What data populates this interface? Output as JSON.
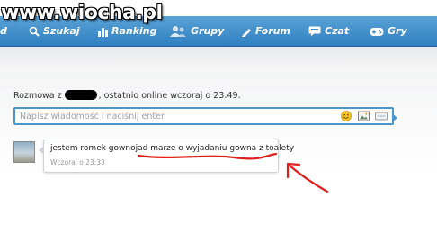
{
  "watermark": "www.wiocha.pl",
  "nav": {
    "items": [
      {
        "label": "d"
      },
      {
        "label": "Szukaj"
      },
      {
        "label": "Ranking"
      },
      {
        "label": "Grupy"
      },
      {
        "label": "Forum"
      },
      {
        "label": "Czat"
      },
      {
        "label": "Gry"
      }
    ]
  },
  "conversation": {
    "heading_prefix": "Rozmowa z",
    "heading_suffix": ", ostatnio online wczoraj o 23:49."
  },
  "composer": {
    "placeholder": "Napisz wiadomość i naciśnij enter",
    "tools": [
      "smiley-icon",
      "image-icon",
      "attachment-icon"
    ]
  },
  "message": {
    "text_part1": "jestem romek gownojad ",
    "text_part2": "marze o wyjadaniu gowna z toalety",
    "time": "Wczoraj o 23:33"
  },
  "colors": {
    "nav_top": "#5aa3d6",
    "nav_bottom": "#2f7fc1",
    "input_border": "#4a97d0",
    "annotation_red": "#e0201c"
  }
}
